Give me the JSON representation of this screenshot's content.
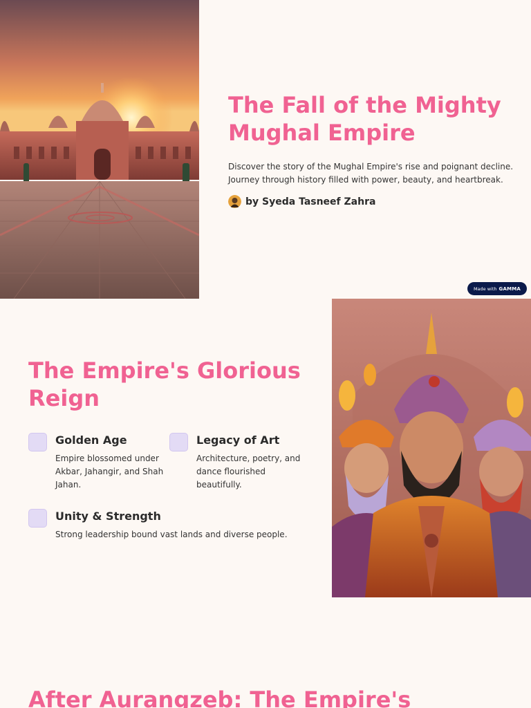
{
  "slide1": {
    "title": "The Fall of the Mighty Mughal Empire",
    "description": "Discover the story of the Mughal Empire's rise and poignant decline. Journey through history filled with power, beauty, and heartbreak.",
    "author": "by Syeda Tasneef Zahra",
    "image": "mughal-palace-at-sunset"
  },
  "badge": {
    "prefix": "Made with",
    "brand": "GAMMA"
  },
  "slide2": {
    "title": "The Empire's Glorious Reign",
    "features": [
      {
        "title": "Golden Age",
        "text": "Empire blossomed under Akbar, Jahangir, and Shah Jahan."
      },
      {
        "title": "Legacy of Art",
        "text": "Architecture, poetry, and dance flourished beautifully."
      },
      {
        "title": "Unity & Strength",
        "text": "Strong leadership bound vast lands and diverse people."
      }
    ],
    "image": "illustrated-mughal-rulers"
  },
  "slide3": {
    "title": "After Aurangzeb: The Empire's"
  },
  "colors": {
    "page_bg": "#fdf8f4",
    "title_pink": "#f06292",
    "chip_lavender": "#e3dbf5",
    "badge_navy": "#0b1a4a"
  }
}
